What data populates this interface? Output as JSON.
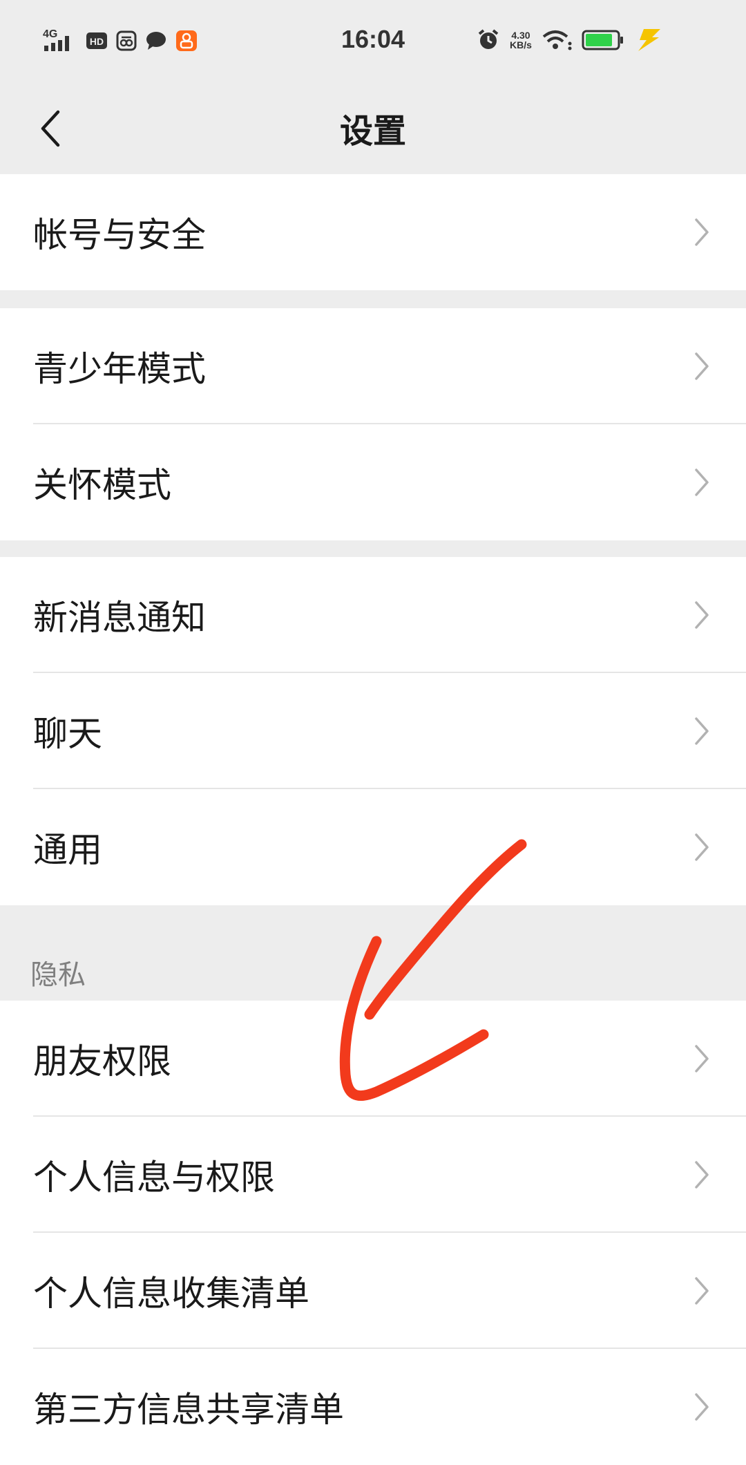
{
  "status_bar": {
    "network": "4G",
    "hd_badge": "HD",
    "time": "16:04",
    "speed_value": "4.30",
    "speed_unit": "KB/s",
    "battery_color": "#2fd14a",
    "charging_color": "#f5c400",
    "app_badge_color": "#ff6a1a"
  },
  "nav": {
    "title": "设置"
  },
  "groups": [
    {
      "items": [
        {
          "label": "帐号与安全"
        }
      ]
    },
    {
      "items": [
        {
          "label": "青少年模式"
        },
        {
          "label": "关怀模式"
        }
      ]
    },
    {
      "items": [
        {
          "label": "新消息通知"
        },
        {
          "label": "聊天"
        },
        {
          "label": "通用"
        }
      ]
    }
  ],
  "privacy_section": {
    "header": "隐私",
    "items": [
      {
        "label": "朋友权限"
      },
      {
        "label": "个人信息与权限"
      },
      {
        "label": "个人信息收集清单"
      },
      {
        "label": "第三方信息共享清单"
      }
    ]
  },
  "annotation": {
    "color": "#f23a1c"
  }
}
